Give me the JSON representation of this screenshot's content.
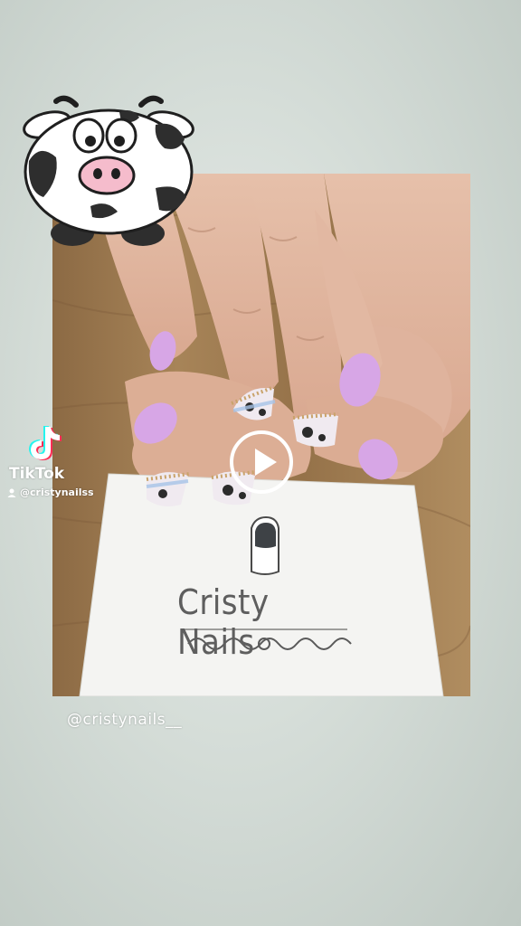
{
  "overlay": {
    "app_name": "TikTok",
    "username": "@cristynailss"
  },
  "card": {
    "brand": "Cristy Nails"
  },
  "caption": "@cristynails__",
  "controls": {
    "play_icon": "play-icon"
  },
  "colors": {
    "background": "#d5ddd8",
    "nail_pink": "#d7a6e6",
    "skin": "#e8c3ad",
    "wood": "#9a7a52",
    "card": "#f4f4f2"
  }
}
